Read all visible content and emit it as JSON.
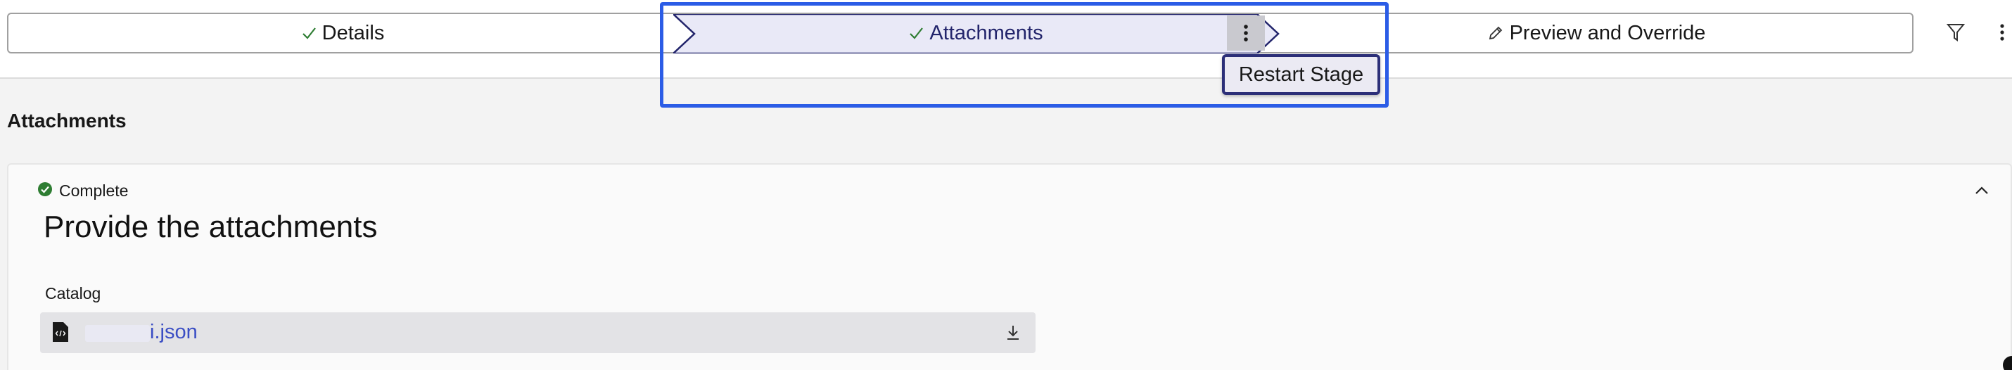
{
  "stages": {
    "details": {
      "label": "Details",
      "icon": "check-icon"
    },
    "attachments": {
      "label": "Attachments",
      "icon": "check-icon"
    },
    "preview": {
      "label": "Preview and Override",
      "icon": "pencil-icon"
    }
  },
  "stage_menu": {
    "restart_label": "Restart Stage"
  },
  "toolbar": {
    "filter_icon": "filter-icon",
    "more_icon": "kebab-icon"
  },
  "section": {
    "title": "Attachments"
  },
  "card": {
    "status_label": "Complete",
    "heading": "Provide the attachments",
    "field_label": "Catalog",
    "file_name": "i.json"
  },
  "colors": {
    "accent": "#2b5ce6",
    "active_stage_bg": "#e9e9f7",
    "active_stage_border": "#22246b",
    "success": "#2e7d32",
    "link": "#3b4ec4"
  }
}
